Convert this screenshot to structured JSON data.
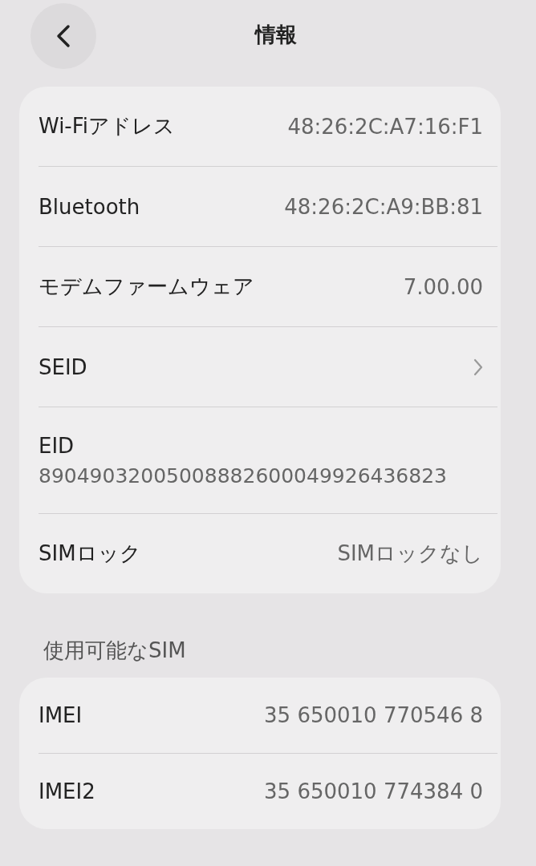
{
  "nav": {
    "title": "情報"
  },
  "groups": [
    {
      "rows": [
        {
          "kind": "value",
          "label": "Wi-Fiアドレス",
          "value": "48:26:2C:A7:16:F1"
        },
        {
          "kind": "value",
          "label": "Bluetooth",
          "value": "48:26:2C:A9:BB:81"
        },
        {
          "kind": "value",
          "label": "モデムファームウェア",
          "value": "7.00.00"
        },
        {
          "kind": "link",
          "label": "SEID"
        },
        {
          "kind": "stacked",
          "label": "EID",
          "value": "89049032005008882600049926436823"
        },
        {
          "kind": "value",
          "label": "SIMロック",
          "value": "SIMロックなし"
        }
      ]
    },
    {
      "header": "使用可能なSIM",
      "rows": [
        {
          "kind": "value",
          "label": "IMEI",
          "value": "35 650010 770546 8"
        },
        {
          "kind": "value",
          "label": "IMEI2",
          "value": "35 650010 774384 0"
        }
      ]
    }
  ]
}
